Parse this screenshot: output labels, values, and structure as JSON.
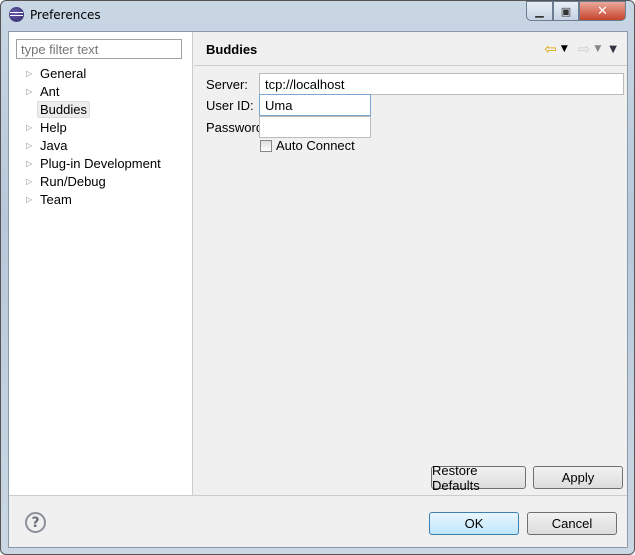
{
  "window": {
    "title": "Preferences",
    "icon": "eclipse-icon",
    "controls": [
      "minimize",
      "maximize",
      "close"
    ]
  },
  "filter": {
    "placeholder": "type filter text"
  },
  "tree": [
    {
      "label": "General",
      "expandable": true
    },
    {
      "label": "Ant",
      "expandable": true
    },
    {
      "label": "Buddies",
      "expandable": false,
      "selected": true
    },
    {
      "label": "Help",
      "expandable": true
    },
    {
      "label": "Java",
      "expandable": true
    },
    {
      "label": "Plug-in Development",
      "expandable": true
    },
    {
      "label": "Run/Debug",
      "expandable": true
    },
    {
      "label": "Team",
      "expandable": true
    }
  ],
  "page": {
    "title": "Buddies",
    "server": {
      "label": "Server:",
      "value": "tcp://localhost"
    },
    "userid": {
      "label": "User ID:",
      "value": "Uma"
    },
    "password": {
      "label": "Password:",
      "value": ""
    },
    "auto_connect": {
      "label": "Auto Connect",
      "checked": false
    }
  },
  "buttons": {
    "restore": "Restore Defaults",
    "apply": "Apply",
    "ok": "OK",
    "cancel": "Cancel"
  }
}
